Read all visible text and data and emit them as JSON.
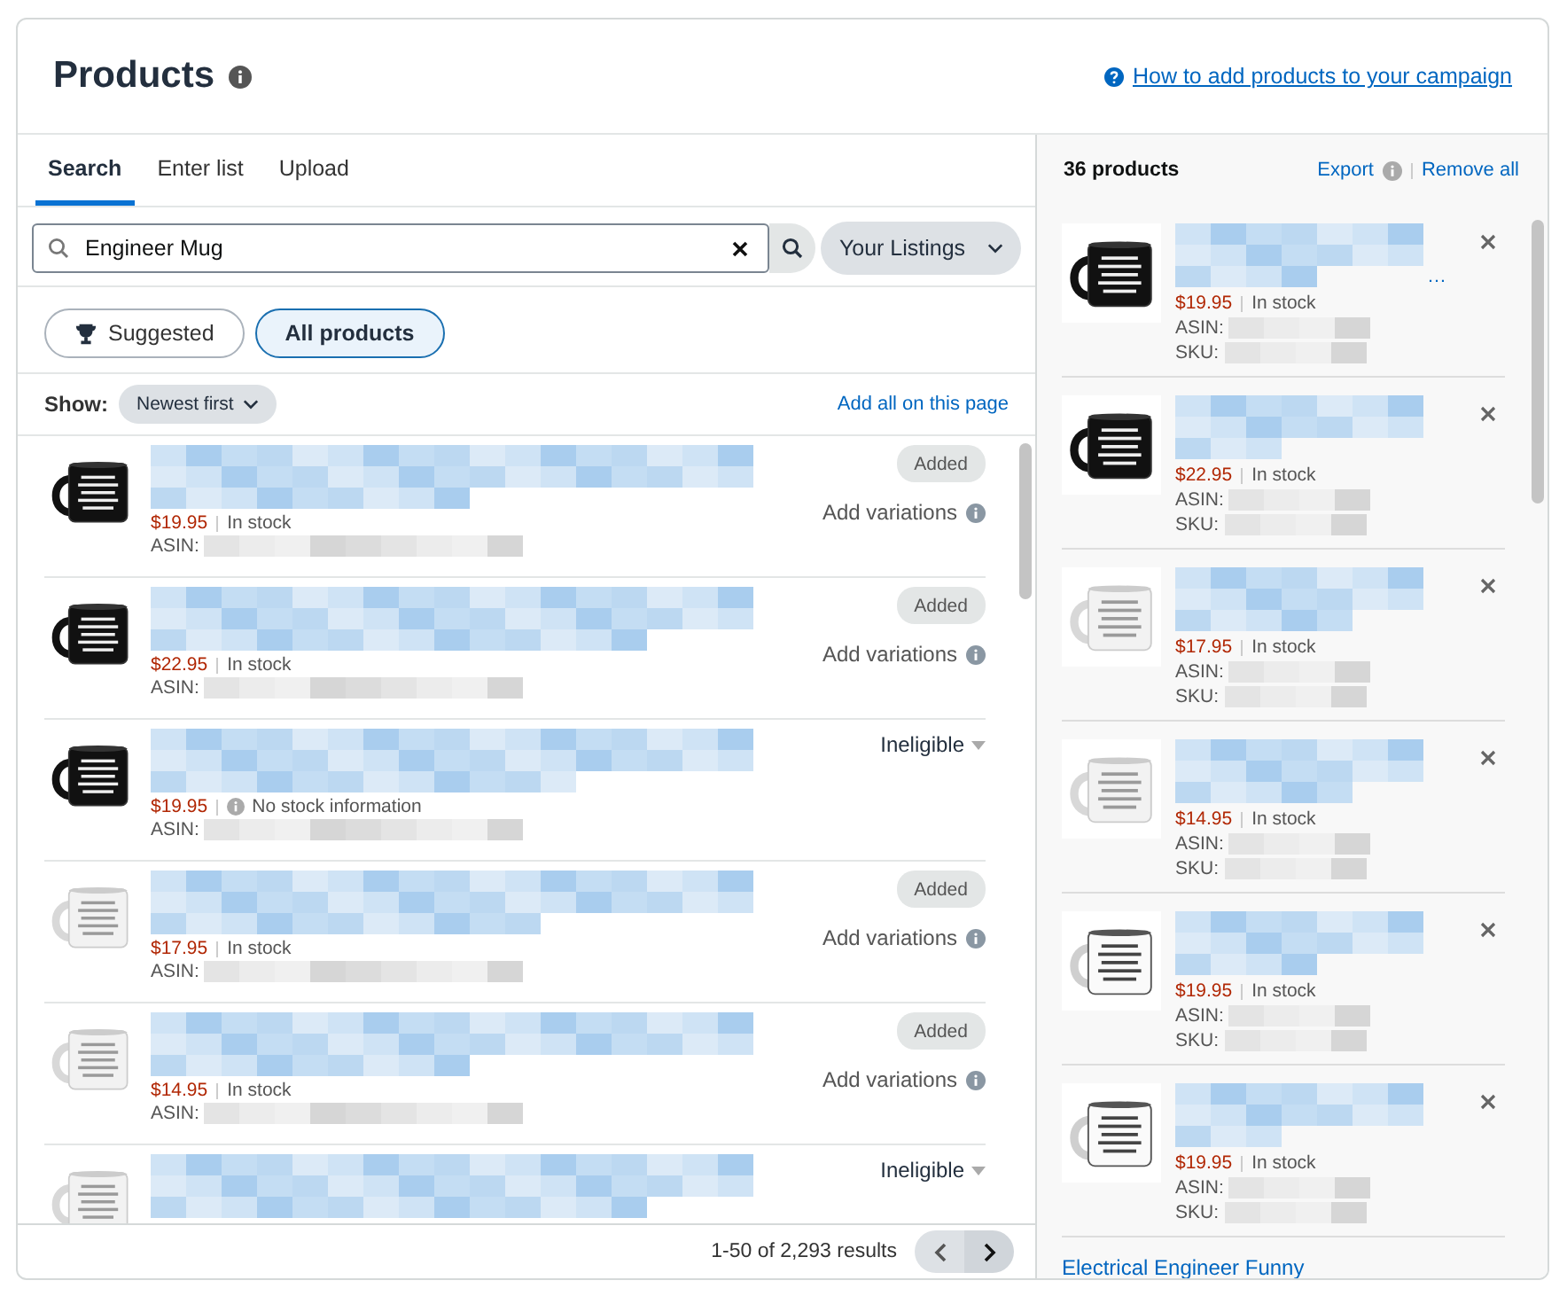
{
  "header": {
    "title": "Products",
    "help_link": "How to add products to your campaign"
  },
  "tabs": [
    {
      "label": "Search",
      "selected": true
    },
    {
      "label": "Enter list",
      "selected": false
    },
    {
      "label": "Upload",
      "selected": false
    }
  ],
  "search": {
    "value": "Engineer Mug",
    "scope": "Your Listings"
  },
  "filters": [
    {
      "label": "Suggested",
      "selected": false
    },
    {
      "label": "All products",
      "selected": true
    }
  ],
  "show": {
    "label": "Show:",
    "sort": "Newest first",
    "add_all": "Add all on this page"
  },
  "results": [
    {
      "kind": "added",
      "price": "$19.95",
      "stock": "In stock",
      "stock_info": false,
      "asin_label": "ASIN:",
      "status_label": "Added",
      "action": "Add variations"
    },
    {
      "kind": "added",
      "price": "$22.95",
      "stock": "In stock",
      "stock_info": false,
      "asin_label": "ASIN:",
      "status_label": "Added",
      "action": "Add variations"
    },
    {
      "kind": "ineligible",
      "price": "$19.95",
      "stock": "No stock information",
      "stock_info": true,
      "asin_label": "ASIN:",
      "status_label": "Ineligible"
    },
    {
      "kind": "added",
      "price": "$17.95",
      "stock": "In stock",
      "stock_info": false,
      "asin_label": "ASIN:",
      "status_label": "Added",
      "action": "Add variations"
    },
    {
      "kind": "added",
      "price": "$14.95",
      "stock": "In stock",
      "stock_info": false,
      "asin_label": "ASIN:",
      "status_label": "Added",
      "action": "Add variations"
    },
    {
      "kind": "ineligible",
      "status_label": "Ineligible"
    }
  ],
  "pagination": {
    "summary": "1-50 of 2,293 results"
  },
  "selected_panel": {
    "count": "36 products",
    "export": "Export",
    "remove_all": "Remove all",
    "items": [
      {
        "title_suffix": "…",
        "price": "$19.95",
        "stock": "In stock",
        "asin_label": "ASIN:",
        "sku_label": "SKU:"
      },
      {
        "price": "$22.95",
        "stock": "In stock",
        "asin_label": "ASIN:",
        "sku_label": "SKU:"
      },
      {
        "price": "$17.95",
        "stock": "In stock",
        "asin_label": "ASIN:",
        "sku_label": "SKU:"
      },
      {
        "price": "$14.95",
        "stock": "In stock",
        "asin_label": "ASIN:",
        "sku_label": "SKU:"
      },
      {
        "price": "$19.95",
        "stock": "In stock",
        "asin_label": "ASIN:",
        "sku_label": "SKU:"
      },
      {
        "price": "$19.95",
        "stock": "In stock",
        "asin_label": "ASIN:",
        "sku_label": "SKU:"
      },
      {
        "title": "Electrical Engineer Funny"
      }
    ]
  }
}
